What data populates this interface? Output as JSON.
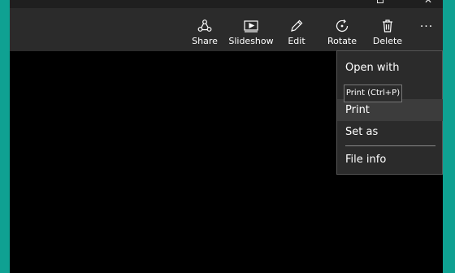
{
  "titlebar": {
    "restore_label": "",
    "close_label": "✕"
  },
  "toolbar": {
    "items": [
      {
        "label": "Share",
        "icon": "share-icon"
      },
      {
        "label": "Slideshow",
        "icon": "slideshow-icon"
      },
      {
        "label": "Edit",
        "icon": "edit-pencil-icon"
      },
      {
        "label": "Rotate",
        "icon": "rotate-icon"
      },
      {
        "label": "Delete",
        "icon": "trash-icon"
      },
      {
        "label": "",
        "icon": "more-ellipsis-icon"
      }
    ],
    "more_glyph": "···"
  },
  "menu": {
    "items": [
      {
        "label": "Open with"
      },
      {
        "label": "Print"
      },
      {
        "label": "Set as"
      },
      {
        "label": "File info"
      }
    ]
  },
  "tooltip": {
    "text": "Print (Ctrl+P)"
  },
  "colors": {
    "desktop": "#0fa192",
    "toolbar": "#2b2b2b",
    "canvas": "#000000",
    "menu_highlight": "#3c3c3c"
  }
}
